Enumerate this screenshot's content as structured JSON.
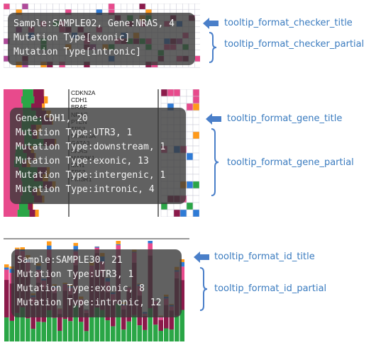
{
  "colors": {
    "label_text": "#3a7bbf",
    "arrow": "#4a7fc9",
    "tooltip_bg": "#3a3a3a",
    "tooltip_text": "#f3f3f3",
    "palette": [
      "#e84a8c",
      "#2aa646",
      "#8b1a4a",
      "#ff9a1a",
      "#2e7bd6",
      "#b04a9a",
      "#d7d7d7"
    ]
  },
  "panels": [
    {
      "id": "checker",
      "tooltip_lines": [
        "Sample:SAMPLE02, Gene:NRAS, 4",
        "Mutation Type[exonic]",
        "Mutation Type[intronic]"
      ],
      "labels": {
        "title": "tooltip_format_checker_title",
        "partial": "tooltip_format_checker_partial"
      }
    },
    {
      "id": "gene",
      "tooltip_lines": [
        "Gene:CDH1, 20",
        "Mutation Type:UTR3, 1",
        "Mutation Type:downstream, 1",
        "Mutation Type:exonic, 13",
        "Mutation Type:intergenic, 1",
        "Mutation Type:intronic, 4"
      ],
      "labels": {
        "title": "tooltip_format_gene_title",
        "partial": "tooltip_format_gene_partial"
      },
      "gene_names": [
        "CDKN2A",
        "CDH1",
        "BRAF",
        "NRAS",
        "PTEN",
        "TP53",
        "DNMT3A",
        "GATA3",
        "KRAS",
        "MAP3K1",
        "IDH1",
        "TP53",
        "PIK3R1"
      ]
    },
    {
      "id": "id",
      "tooltip_lines": [
        "Sample:SAMPLE30, 21",
        "Mutation Type:UTR3, 1",
        "Mutation Type:exonic, 8",
        "Mutation Type:intronic, 12"
      ],
      "labels": {
        "title": "tooltip_format_id_title",
        "partial": "tooltip_format_id_partial"
      }
    }
  ]
}
